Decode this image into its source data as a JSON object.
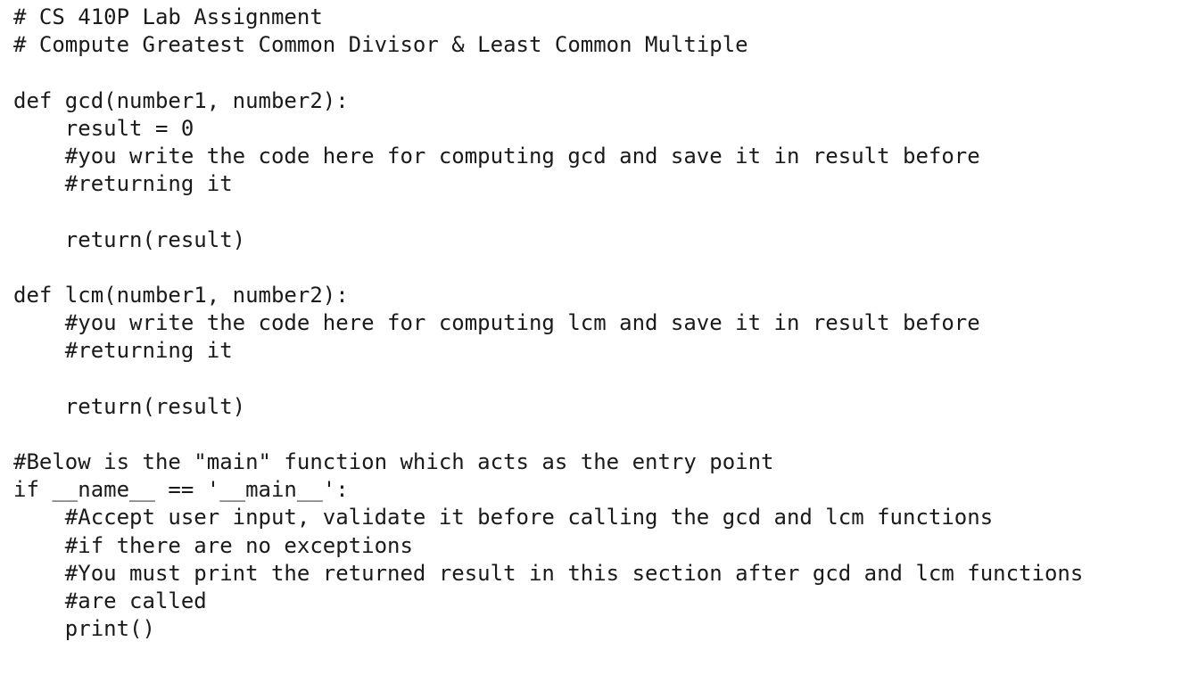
{
  "document": {
    "kind": "python-source-listing",
    "title": "CS 410P Lab Assignment",
    "subtitle": "Compute Greatest Common Divisor & Least Common Multiple",
    "background_color": "#ffffff",
    "text_color": "#1a1a1a",
    "font_kind": "monospace",
    "indent_spaces": 4,
    "total_line_slots": 20
  },
  "code": {
    "lines": [
      "# CS 410P Lab Assignment",
      "# Compute Greatest Common Divisor & Least Common Multiple",
      "",
      "def gcd(number1, number2):",
      "    result = 0",
      "    #you write the code here for computing gcd and save it in result before",
      "    #returning it",
      "",
      "    return(result)",
      "",
      "def lcm(number1, number2):",
      "    #you write the code here for computing lcm and save it in result before",
      "    #returning it",
      "",
      "    return(result)",
      "",
      "#Below is the \"main\" function which acts as the entry point",
      "if __name__ == '__main__':",
      "    #Accept user input, validate it before calling the gcd and lcm functions",
      "    #if there are no exceptions",
      "    #You must print the returned result in this section after gcd and lcm functions",
      "    #are called",
      "    print()"
    ]
  }
}
